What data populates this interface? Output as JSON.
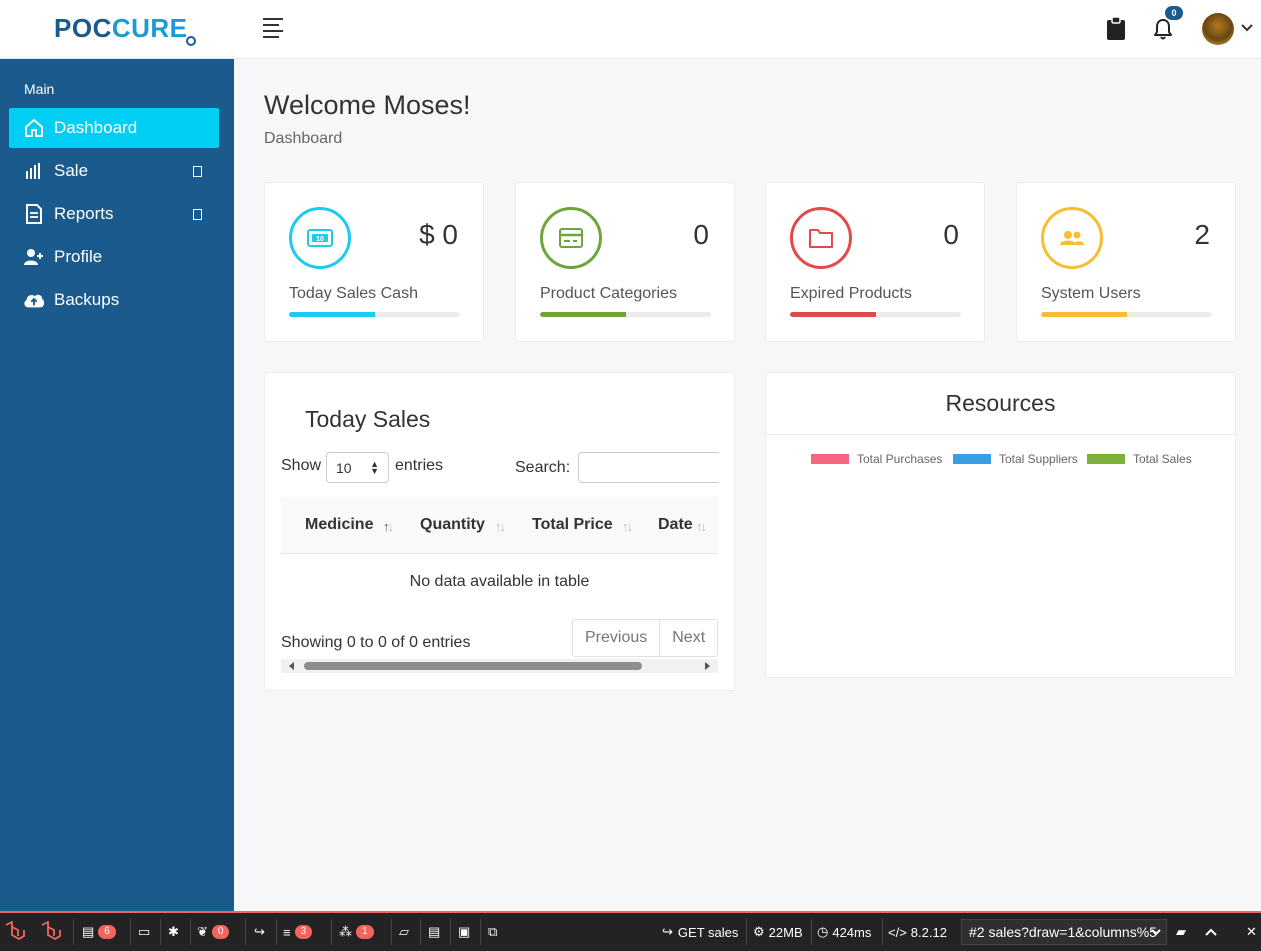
{
  "header": {
    "logo_left": "POC",
    "logo_right": "CURE",
    "notification_count": "0"
  },
  "sidebar": {
    "section_title": "Main",
    "items": [
      {
        "label": "Dashboard",
        "icon": "home-icon",
        "active": true
      },
      {
        "label": "Sale",
        "icon": "bar-chart-icon",
        "has_submenu": true
      },
      {
        "label": "Reports",
        "icon": "document-icon",
        "has_submenu": true
      },
      {
        "label": "Profile",
        "icon": "user-plus-icon"
      },
      {
        "label": "Backups",
        "icon": "cloud-upload-icon"
      }
    ]
  },
  "page": {
    "welcome": "Welcome Moses!",
    "breadcrumb": "Dashboard"
  },
  "stats": [
    {
      "value": "$ 0",
      "label": "Today Sales Cash",
      "color": "#1ccbf0",
      "progress": 0.5,
      "icon": "money-icon"
    },
    {
      "value": "0",
      "label": "Product Categories",
      "color": "#6ea53a",
      "progress": 0.5,
      "icon": "credit-card-icon"
    },
    {
      "value": "0",
      "label": "Expired Products",
      "color": "#e04a4a",
      "progress": 0.5,
      "icon": "folder-icon"
    },
    {
      "value": "2",
      "label": "System Users",
      "color": "#f9bd33",
      "progress": 0.5,
      "icon": "users-icon"
    }
  ],
  "today_sales": {
    "title": "Today Sales",
    "show_label": "Show",
    "page_length": "10",
    "entries_label": "entries",
    "search_label": "Search:",
    "search_value": "",
    "columns": [
      "Medicine",
      "Quantity",
      "Total Price",
      "Date"
    ],
    "empty_message": "No data available in table",
    "info": "Showing 0 to 0 of 0 entries",
    "prev_label": "Previous",
    "next_label": "Next"
  },
  "resources": {
    "title": "Resources",
    "legend": [
      {
        "name": "Total Purchases",
        "color": "#f4667f"
      },
      {
        "name": "Total Suppliers",
        "color": "#3a9ee4"
      },
      {
        "name": "Total Sales",
        "color": "#7bb03a"
      }
    ]
  },
  "debugbar": {
    "messages_count": "6",
    "logs_count": "0",
    "queries_count": "3",
    "models_count": "1",
    "request": "GET sales",
    "memory": "22MB",
    "time": "424ms",
    "php_version": "8.2.12",
    "request_select": "#2 sales?draw=1&columns%5",
    "accent": "#f4645f"
  }
}
